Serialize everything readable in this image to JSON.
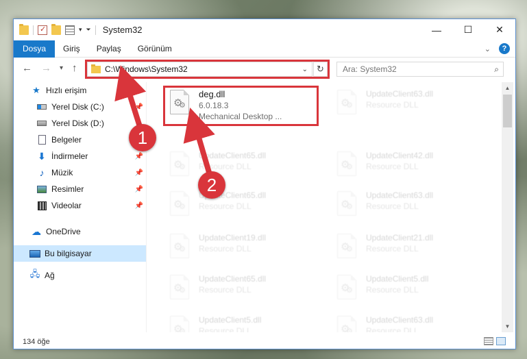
{
  "window": {
    "title": "System32",
    "controls": {
      "minimize": "—",
      "maximize": "☐",
      "close": "✕"
    }
  },
  "ribbon": {
    "tabs": [
      "Dosya",
      "Giriş",
      "Paylaş",
      "Görünüm"
    ],
    "help_label": "?"
  },
  "navigation": {
    "address_path": "C:\\Windows\\System32",
    "search_placeholder": "Ara: System32"
  },
  "sidebar": {
    "items": [
      {
        "label": "Hızlı erişim",
        "icon": "star-icon"
      },
      {
        "label": "Yerel Disk (C:)",
        "icon": "drive-icon",
        "pinned": true
      },
      {
        "label": "Yerel Disk (D:)",
        "icon": "drive-icon"
      },
      {
        "label": "Belgeler",
        "icon": "documents-icon"
      },
      {
        "label": "İndirmeler",
        "icon": "downloads-icon",
        "pinned": true
      },
      {
        "label": "Müzik",
        "icon": "music-icon",
        "pinned": true
      },
      {
        "label": "Resimler",
        "icon": "pictures-icon",
        "pinned": true
      },
      {
        "label": "Videolar",
        "icon": "videos-icon",
        "pinned": true
      },
      {
        "label": "OneDrive",
        "icon": "cloud-icon"
      },
      {
        "label": "Bu bilgisayar",
        "icon": "computer-icon",
        "selected": true
      },
      {
        "label": "Ağ",
        "icon": "network-icon"
      }
    ]
  },
  "files": [
    {
      "name": "deg.dll",
      "version": "6.0.18.3",
      "description": "Mechanical Desktop ...",
      "highlighted": true
    },
    {
      "name": "UpdateClient63.dll",
      "description": "Resource DLL"
    },
    {
      "name": "UpdateClient65.dll",
      "description": "Resource DLL"
    },
    {
      "name": "UpdateClient42.dll",
      "description": "Resource DLL"
    },
    {
      "name": "UpdateClient65.dll",
      "description": "Resource DLL"
    },
    {
      "name": "UpdateClient63.dll",
      "description": "Resource DLL"
    },
    {
      "name": "UpdateClient19.dll",
      "description": "Resource DLL"
    },
    {
      "name": "UpdateClient21.dll",
      "description": "Resource DLL"
    },
    {
      "name": "UpdateClient65.dll",
      "description": "Resource DLL"
    },
    {
      "name": "UpdateClient5.dll",
      "description": "Resource DLL"
    },
    {
      "name": "UpdateClient5.dll",
      "description": "Resource DLL"
    },
    {
      "name": "UpdateClient63.dll",
      "description": "Resource DLL"
    }
  ],
  "status": {
    "item_count": "134 öğe"
  },
  "annotations": {
    "step1": "1",
    "step2": "2",
    "highlight_color": "#d9353b"
  },
  "colors": {
    "accent": "#1979ca",
    "selected": "#cce8ff"
  }
}
